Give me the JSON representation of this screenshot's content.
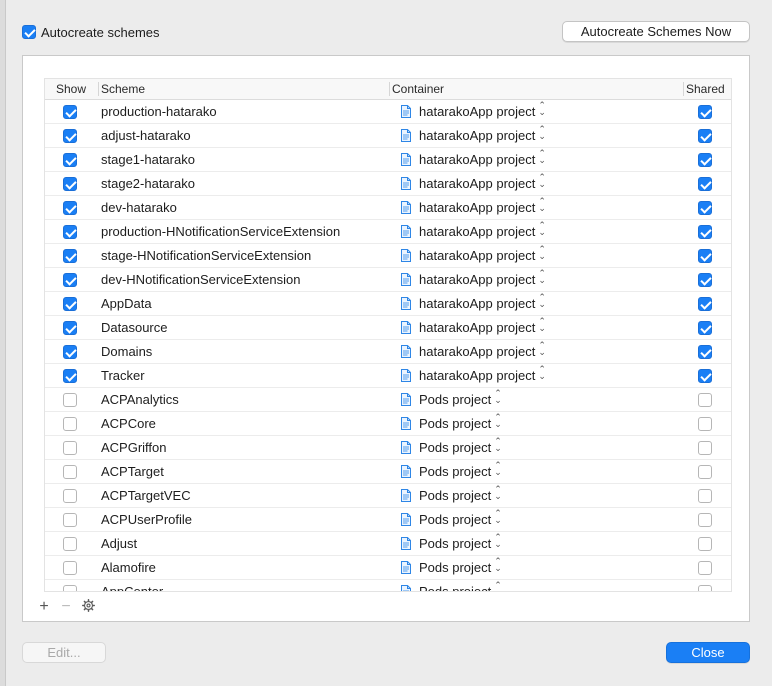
{
  "autocreate": {
    "label": "Autocreate schemes",
    "checked": true
  },
  "buttons": {
    "autocreate_now": "Autocreate Schemes Now",
    "edit": "Edit...",
    "close": "Close"
  },
  "columns": {
    "show": "Show",
    "scheme": "Scheme",
    "container": "Container",
    "shared": "Shared"
  },
  "colors": {
    "accent": "#1a7ff5"
  },
  "icons": {
    "container": "document-icon",
    "stepper": "up-down-chevron-icon"
  },
  "toolbar": {
    "add": "+",
    "remove": "−",
    "settings": "gear-icon"
  },
  "rows": [
    {
      "show": true,
      "scheme": "production-hatarako",
      "container": "hatarakoApp project",
      "shared": true
    },
    {
      "show": true,
      "scheme": "adjust-hatarako",
      "container": "hatarakoApp project",
      "shared": true
    },
    {
      "show": true,
      "scheme": "stage1-hatarako",
      "container": "hatarakoApp project",
      "shared": true
    },
    {
      "show": true,
      "scheme": "stage2-hatarako",
      "container": "hatarakoApp project",
      "shared": true
    },
    {
      "show": true,
      "scheme": "dev-hatarako",
      "container": "hatarakoApp project",
      "shared": true
    },
    {
      "show": true,
      "scheme": "production-HNotificationServiceExtension",
      "container": "hatarakoApp project",
      "shared": true
    },
    {
      "show": true,
      "scheme": "stage-HNotificationServiceExtension",
      "container": "hatarakoApp project",
      "shared": true
    },
    {
      "show": true,
      "scheme": "dev-HNotificationServiceExtension",
      "container": "hatarakoApp project",
      "shared": true
    },
    {
      "show": true,
      "scheme": "AppData",
      "container": "hatarakoApp project",
      "shared": true
    },
    {
      "show": true,
      "scheme": "Datasource",
      "container": "hatarakoApp project",
      "shared": true
    },
    {
      "show": true,
      "scheme": "Domains",
      "container": "hatarakoApp project",
      "shared": true
    },
    {
      "show": true,
      "scheme": "Tracker",
      "container": "hatarakoApp project",
      "shared": true
    },
    {
      "show": false,
      "scheme": "ACPAnalytics",
      "container": "Pods project",
      "shared": false
    },
    {
      "show": false,
      "scheme": "ACPCore",
      "container": "Pods project",
      "shared": false
    },
    {
      "show": false,
      "scheme": "ACPGriffon",
      "container": "Pods project",
      "shared": false
    },
    {
      "show": false,
      "scheme": "ACPTarget",
      "container": "Pods project",
      "shared": false
    },
    {
      "show": false,
      "scheme": "ACPTargetVEC",
      "container": "Pods project",
      "shared": false
    },
    {
      "show": false,
      "scheme": "ACPUserProfile",
      "container": "Pods project",
      "shared": false
    },
    {
      "show": false,
      "scheme": "Adjust",
      "container": "Pods project",
      "shared": false
    },
    {
      "show": false,
      "scheme": "Alamofire",
      "container": "Pods project",
      "shared": false
    },
    {
      "show": false,
      "scheme": "AppCenter",
      "container": "Pods project",
      "shared": false
    }
  ]
}
